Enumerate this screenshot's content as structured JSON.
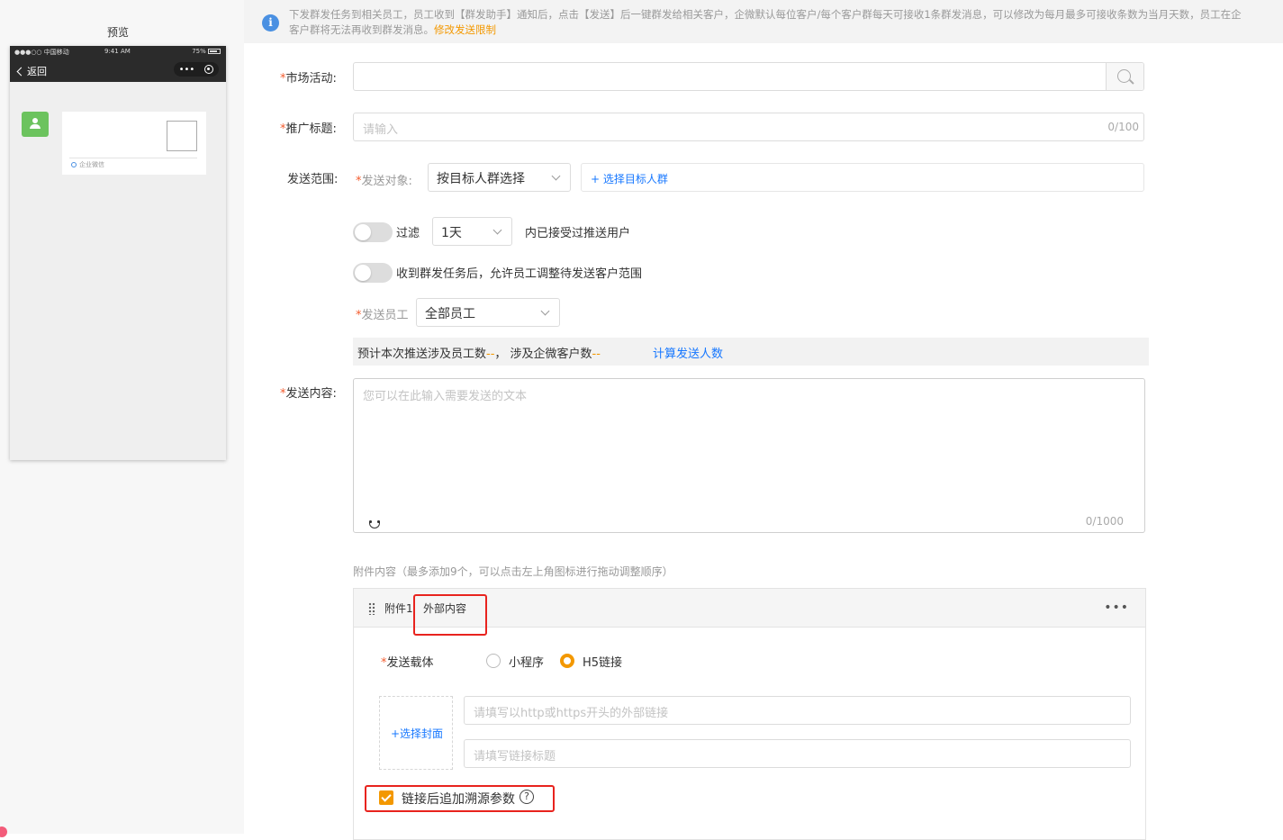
{
  "preview": {
    "title": "预览",
    "status_carrier": "●●●○○ 中国移动",
    "status_time": "9:41 AM",
    "status_battery": "75%",
    "back_label": "返回",
    "capsule_dots": "•••",
    "card_footer": "企业微信"
  },
  "notice": {
    "line1": "下发群发任务到相关员工，员工收到【群发助手】通知后，点击【发送】后一键群发给相关客户，企微默认每位客户/每个客户群每天可接收1条群发消息，可以修改为每月最多可接收条数为当月天数，员工在企",
    "line2": "客户群将无法再收到群发消息。",
    "link": "修改发送限制"
  },
  "form": {
    "activity_label": "市场活动:",
    "title_label": "推广标题:",
    "title_placeholder": "请输入",
    "title_count": "0/100",
    "scope_label": "发送范围:",
    "target_label": "发送对象:",
    "target_value": "按目标人群选择",
    "choose_group": "+ 选择目标人群",
    "filter_label": "过滤",
    "filter_days": "1天",
    "filter_suffix": "内已接受过推送用户",
    "allow_adjust": "收到群发任务后，允许员工调整待发送客户范围",
    "staff_label": "发送员工",
    "staff_value": "全部员工",
    "estimate_prefix": "预计本次推送涉及员工数",
    "estimate_staff": "--",
    "estimate_mid": "，  涉及企微客户数",
    "estimate_customers": "--",
    "calc_link": "计算发送人数",
    "content_label": "发送内容:",
    "content_placeholder": "您可以在此输入需要发送的文本",
    "content_count": "0/1000",
    "attach_hint": "附件内容（最多添加9个，可以点击左上角图标进行拖动调整顺序）",
    "required_mark": "*"
  },
  "attachment": {
    "index_label": "附件1",
    "type_label": "外部内容",
    "more": "•••",
    "carrier_label": "发送载体",
    "option_miniprogram": "小程序",
    "option_h5": "H5链接",
    "cover_label": "+选择封面",
    "url_placeholder": "请填写以http或https开头的外部链接",
    "link_title_placeholder": "请填写链接标题",
    "trace_label": "链接后追加溯源参数",
    "help": "?"
  },
  "colors": {
    "accent_orange": "#f39800",
    "required_red": "#f35c2e",
    "link_blue": "#1677ff",
    "highlight_red": "#e8231e",
    "avatar_green": "#6cc35e"
  }
}
